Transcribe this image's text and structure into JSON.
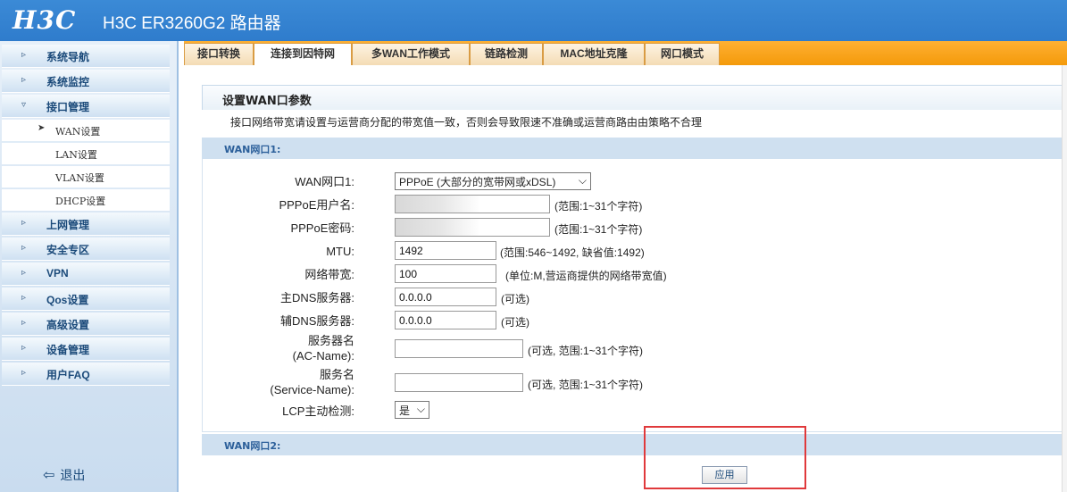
{
  "header": {
    "logo": "H3C",
    "title": "H3C ER3260G2 路由器"
  },
  "sidebar": {
    "items": [
      {
        "label": "系统导航",
        "bullet": "▹"
      },
      {
        "label": "系统监控",
        "bullet": "▹"
      },
      {
        "label": "接口管理",
        "bullet": "▿"
      },
      {
        "label": "上网管理",
        "bullet": "▹"
      },
      {
        "label": "安全专区",
        "bullet": "▹"
      },
      {
        "label": "VPN",
        "bullet": "▹"
      },
      {
        "label": "Qos设置",
        "bullet": "▹"
      },
      {
        "label": "高级设置",
        "bullet": "▹"
      },
      {
        "label": "设备管理",
        "bullet": "▹"
      },
      {
        "label": "用户FAQ",
        "bullet": "▹"
      }
    ],
    "subitems": [
      {
        "label": "WAN设置",
        "active": true
      },
      {
        "label": "LAN设置"
      },
      {
        "label": "VLAN设置"
      },
      {
        "label": "DHCP设置"
      }
    ],
    "logout": "退出"
  },
  "tabs": [
    {
      "label": "接口转换"
    },
    {
      "label": "连接到因特网",
      "active": true
    },
    {
      "label": "多WAN工作模式"
    },
    {
      "label": "链路检测"
    },
    {
      "label": "MAC地址克隆"
    },
    {
      "label": "网口模式"
    }
  ],
  "panel": {
    "title": "设置WAN口参数",
    "notice": "接口网络带宽请设置与运营商分配的带宽值一致，否则会导致限速不准确或运营商路由由策略不合理",
    "section1": "WAN网口1:",
    "section2": "WAN网口2:"
  },
  "form": {
    "wan_port": {
      "label": "WAN网口1:",
      "value": "PPPoE (大部分的宽带网或xDSL)"
    },
    "pppoe_user": {
      "label": "PPPoE用户名:",
      "value": "",
      "hint": "(范围:1~31个字符)"
    },
    "pppoe_pass": {
      "label": "PPPoE密码:",
      "value": "",
      "hint": "(范围:1~31个字符)"
    },
    "mtu": {
      "label": "MTU:",
      "value": "1492",
      "hint": "(范围:546~1492, 缺省值:1492)"
    },
    "bandwidth": {
      "label": "网络带宽:",
      "value": "100",
      "hint": "(单位:M,营运商提供的网络带宽值)"
    },
    "dns1": {
      "label": "主DNS服务器:",
      "value": "0.0.0.0",
      "hint": "(可选)"
    },
    "dns2": {
      "label": "辅DNS服务器:",
      "value": "0.0.0.0",
      "hint": "(可选)"
    },
    "ac_name": {
      "label_line1": "服务器名",
      "label_line2": "(AC-Name):",
      "value": "",
      "hint": "(可选, 范围:1~31个字符)"
    },
    "service_name": {
      "label_line1": "服务名",
      "label_line2": "(Service-Name):",
      "value": "",
      "hint": "(可选, 范围:1~31个字符)"
    },
    "lcp": {
      "label": "LCP主动检测:",
      "value": "是"
    }
  },
  "apply_label": "应用",
  "colors": {
    "header": "#2f7ccc",
    "tabbar": "#f49a0a",
    "section": "#cfe0f0",
    "highlight": "#e0393b"
  }
}
